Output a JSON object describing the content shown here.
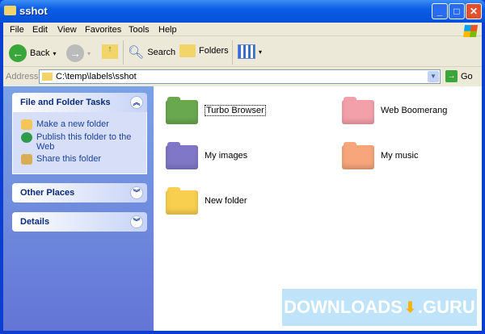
{
  "window": {
    "title": "sshot",
    "minimize": "_",
    "maximize": "□",
    "close": "✕"
  },
  "menu": [
    "File",
    "Edit",
    "View",
    "Favorites",
    "Tools",
    "Help"
  ],
  "toolbar": {
    "back": "Back",
    "search": "Search",
    "folders": "Folders"
  },
  "address": {
    "label": "Address",
    "value": "C:\\temp\\labels\\sshot",
    "go": "Go"
  },
  "sidebar": {
    "tasks_title": "File and Folder Tasks",
    "tasks": [
      "Make a new folder",
      "Publish this folder to the Web",
      "Share this folder"
    ],
    "other_places": "Other Places",
    "details": "Details"
  },
  "folders": [
    {
      "name": "Turbo Browser",
      "color": "#6aa84f"
    },
    {
      "name": "Web Boomerang",
      "color": "#f4a0ab"
    },
    {
      "name": "My images",
      "color": "#8077c8"
    },
    {
      "name": "My music",
      "color": "#f7a57a"
    },
    {
      "name": "New folder",
      "color": "#f8cf4e"
    }
  ],
  "watermark": "DOWNLOADS .GURU"
}
